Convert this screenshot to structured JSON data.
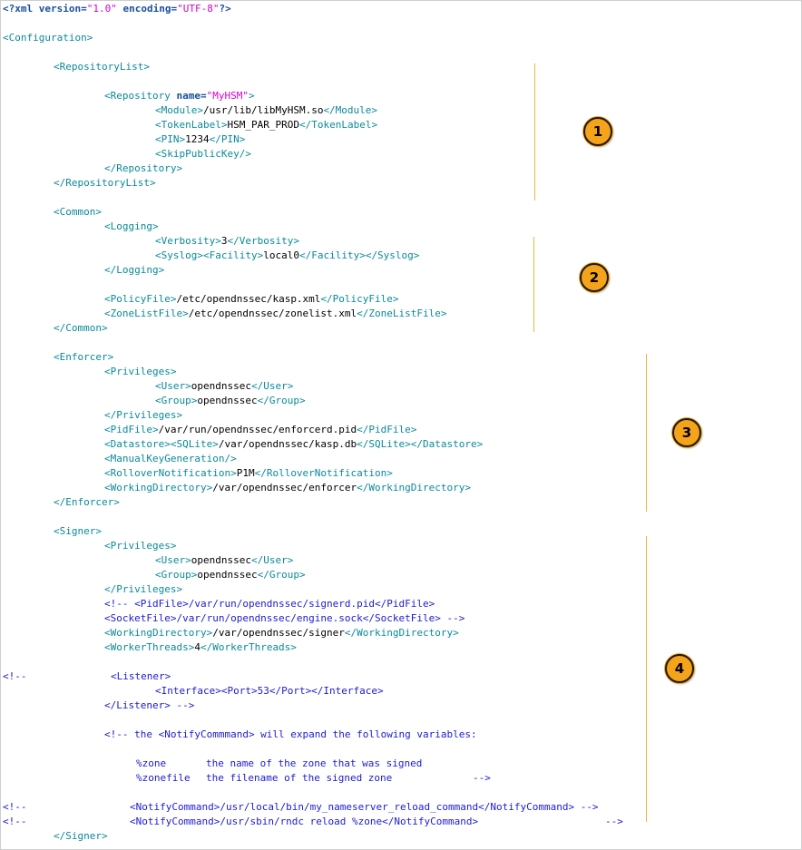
{
  "lines": {
    "l0": {
      "pi_open": "<?xml ",
      "ver_attr": "version=",
      "ver_val": "\"1.0\"",
      "enc_attr": " encoding=",
      "enc_val": "\"UTF-8\"",
      "pi_close": "?>"
    },
    "l2": "<Configuration>",
    "l4": "<RepositoryList>",
    "l6": {
      "open": "<Repository ",
      "attr": "name=",
      "val": "\"MyHSM\"",
      "close": ">"
    },
    "l7": {
      "o": "<Module>",
      "v": "/usr/lib/libMyHSM.so",
      "c": "</Module>"
    },
    "l8": {
      "o": "<TokenLabel>",
      "v": "HSM_PAR_PROD",
      "c": "</TokenLabel>"
    },
    "l9": {
      "o": "<PIN>",
      "v": "1234",
      "c": "</PIN>"
    },
    "l10": "<SkipPublicKey/>",
    "l11": "</Repository>",
    "l12": "</RepositoryList>",
    "l14": "<Common>",
    "l15": "<Logging>",
    "l16": {
      "o": "<Verbosity>",
      "v": "3",
      "c": "</Verbosity>"
    },
    "l17": {
      "o": "<Syslog><Facility>",
      "v": "local0",
      "c": "</Facility></Syslog>"
    },
    "l18": "</Logging>",
    "l20": {
      "o": "<PolicyFile>",
      "v": "/etc/opendnssec/kasp.xml",
      "c": "</PolicyFile>"
    },
    "l21": {
      "o": "<ZoneListFile>",
      "v": "/etc/opendnssec/zonelist.xml",
      "c": "</ZoneListFile>"
    },
    "l22": "</Common>",
    "l24": "<Enforcer>",
    "l25": "<Privileges>",
    "l26": {
      "o": "<User>",
      "v": "opendnssec",
      "c": "</User>"
    },
    "l27": {
      "o": "<Group>",
      "v": "opendnssec",
      "c": "</Group>"
    },
    "l28": "</Privileges>",
    "l29": {
      "o": "<PidFile>",
      "v": "/var/run/opendnssec/enforcerd.pid",
      "c": "</PidFile>"
    },
    "l30": {
      "o": "<Datastore><SQLite>",
      "v": "/var/opendnssec/kasp.db",
      "c": "</SQLite></Datastore>"
    },
    "l31": "<ManualKeyGeneration/>",
    "l32": {
      "o": "<RolloverNotification>",
      "v": "P1M",
      "c": "</RolloverNotification>"
    },
    "l33": {
      "o": "<WorkingDirectory>",
      "v": "/var/opendnssec/enforcer",
      "c": "</WorkingDirectory>"
    },
    "l34": "</Enforcer>",
    "l36": "<Signer>",
    "l37": "<Privileges>",
    "l38": {
      "o": "<User>",
      "v": "opendnssec",
      "c": "</User>"
    },
    "l39": {
      "o": "<Group>",
      "v": "opendnssec",
      "c": "</Group>"
    },
    "l40": "</Privileges>",
    "l41": "<!-- <PidFile>/var/run/opendnssec/signerd.pid</PidFile>",
    "l42": "<SocketFile>/var/run/opendnssec/engine.sock</SocketFile> -->",
    "l43": {
      "o": "<WorkingDirectory>",
      "v": "/var/opendnssec/signer",
      "c": "</WorkingDirectory>"
    },
    "l44": {
      "o": "<WorkerThreads>",
      "v": "4",
      "c": "</WorkerThreads>"
    },
    "l46": {
      "pre": "<!--",
      "rest": "<Listener>"
    },
    "l47": "<Interface><Port>53</Port></Interface>",
    "l48": "</Listener> -->",
    "l50": "<!-- the <NotifyCommmand> will expand the following variables:",
    "l52": {
      "var": "%zone",
      "desc": "the name of the zone that was signed"
    },
    "l53": {
      "var": "%zonefile",
      "desc": "the filename of the signed zone",
      "end": "-->"
    },
    "l55": {
      "pre": "<!--",
      "rest": "<NotifyCommand>/usr/local/bin/my_nameserver_reload_command</NotifyCommand> -->"
    },
    "l56": {
      "pre": "<!--",
      "rest": "<NotifyCommand>/usr/sbin/rndc reload %zone</NotifyCommand>",
      "end": "-->"
    },
    "l57": "</Signer>"
  },
  "badges": [
    "1",
    "2",
    "3",
    "4"
  ],
  "colors": {
    "tag": "#0a8a9a",
    "string": "#d400d4",
    "comment": "#1b1bd6",
    "accent": "#f5a318"
  }
}
